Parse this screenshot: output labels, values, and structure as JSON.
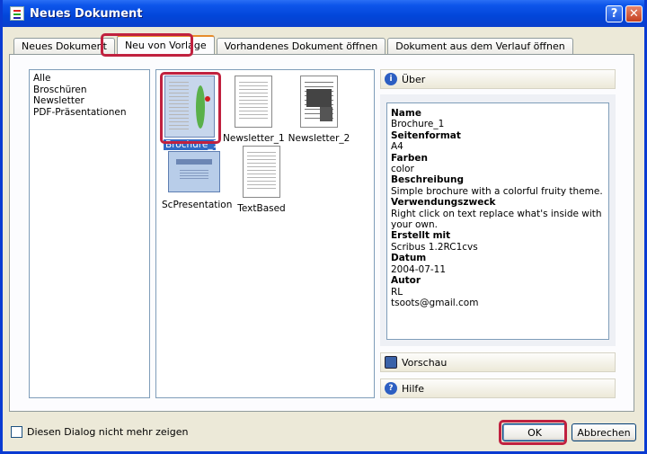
{
  "window": {
    "title": "Neues Dokument",
    "help_glyph": "?",
    "close_glyph": "✕"
  },
  "tabs": [
    {
      "label": "Neues Dokument"
    },
    {
      "label": "Neu von Vorlage"
    },
    {
      "label": "Vorhandenes Dokument öffnen"
    },
    {
      "label": "Dokument aus dem Verlauf öffnen"
    }
  ],
  "categories": [
    "Alle",
    "Broschüren",
    "Newsletter",
    "PDF-Präsentationen"
  ],
  "templates": [
    {
      "label": "Brochure_1"
    },
    {
      "label": "Newsletter_1"
    },
    {
      "label": "Newsletter_2"
    },
    {
      "label": "ScPresentation"
    },
    {
      "label": "TextBased"
    }
  ],
  "sections": {
    "about": "Über",
    "preview": "Vorschau",
    "help": "Hilfe",
    "info_glyph": "i",
    "help_glyph": "?"
  },
  "about": {
    "name_key": "Name",
    "name_val": "Brochure_1",
    "format_key": "Seitenformat",
    "format_val": "A4",
    "colors_key": "Farben",
    "colors_val": "color",
    "desc_key": "Beschreibung",
    "desc_val": "Simple brochure with a colorful fruity theme.",
    "usage_key": "Verwendungszweck",
    "usage_val": "Right click on text replace what's inside with your own.",
    "created_key": "Erstellt mit",
    "created_val": "Scribus 1.2RC1cvs",
    "date_key": "Datum",
    "date_val": "2004-07-11",
    "author_key": "Autor",
    "author_val": "RL",
    "email_val": "tsoots@gmail.com"
  },
  "footer": {
    "dont_show": "Diesen Dialog nicht mehr zeigen",
    "ok": "OK",
    "cancel": "Abbrechen"
  },
  "thumb_text": {
    "presentation_title": "Presentation"
  },
  "colors": {
    "highlight": "#c0213f",
    "selection": "#316ac5",
    "titlebar": "#0246d9"
  }
}
